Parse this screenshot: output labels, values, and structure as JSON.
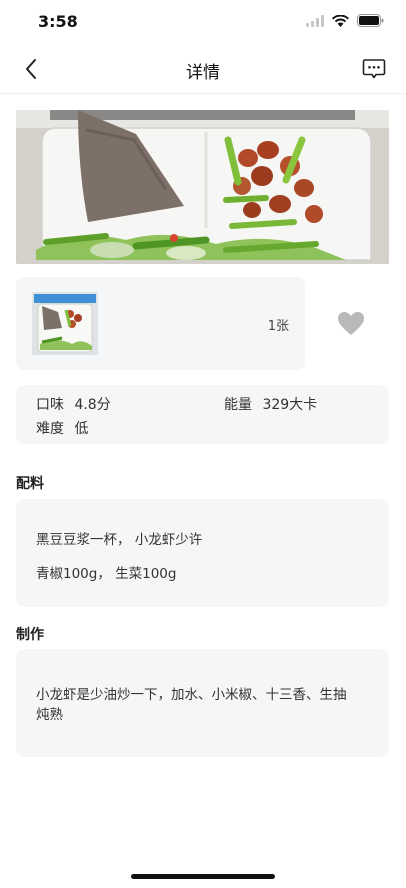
{
  "status_bar": {
    "time": "3:58"
  },
  "nav": {
    "title": "详情"
  },
  "gallery": {
    "count_label": "1张"
  },
  "info": {
    "taste_label": "口味",
    "taste_value": "4.8分",
    "energy_label": "能量",
    "energy_value": "329大卡",
    "difficulty_label": "难度",
    "difficulty_value": "低"
  },
  "ingredients": {
    "title": "配料",
    "lines": [
      "黑豆豆浆一杯，  小龙虾少许",
      "青椒100g，  生菜100g"
    ]
  },
  "method": {
    "title": "制作",
    "text": "小龙虾是少油炒一下，加水、小米椒、十三香、生抽炖熟"
  },
  "colors": {
    "card_bg": "#f5f6f7",
    "heart": "#b9b9b9"
  }
}
